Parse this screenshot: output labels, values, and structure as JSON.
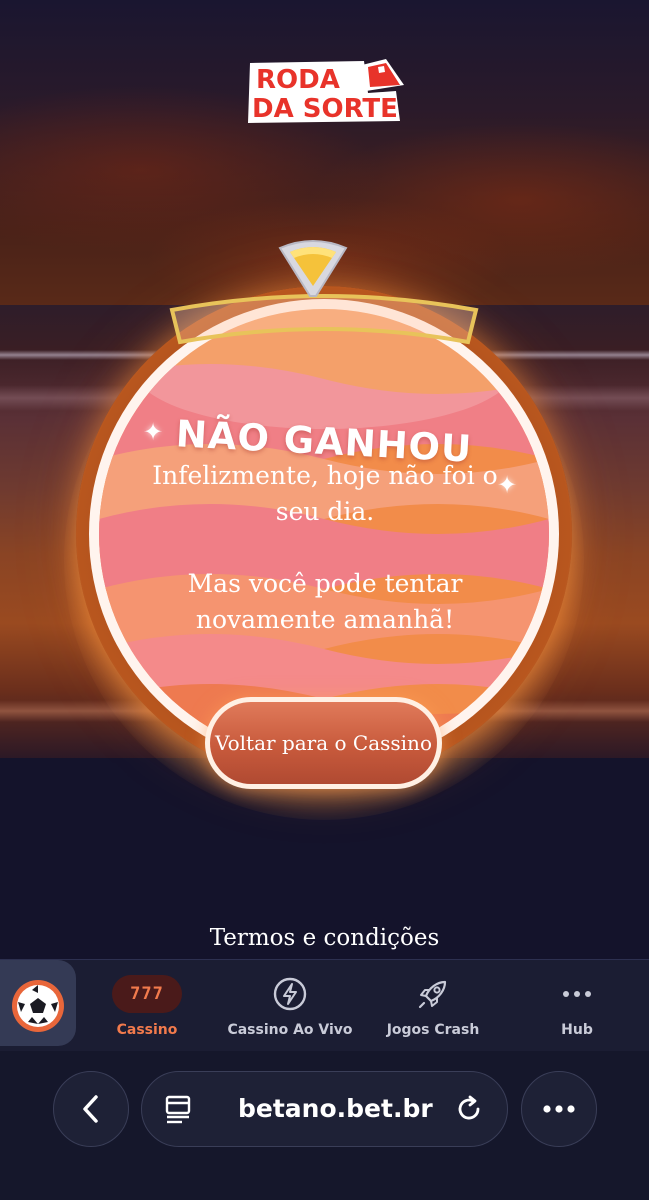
{
  "logo": {
    "line1": "RODA",
    "line2": "DA SORTE"
  },
  "result": {
    "title": "NÃO GANHOU",
    "message_line1": "Infelizmente, hoje não foi o seu dia.",
    "message_line2": "Mas você pode tentar novamente amanhã!",
    "button_label": "Voltar para o Cassino"
  },
  "terms_label": "Termos e condições",
  "bottom_nav": {
    "items": [
      {
        "label": "Cassino",
        "icon": "slot-777-icon",
        "icon_text": "777",
        "active": true
      },
      {
        "label": "Cassino Ao Vivo",
        "icon": "lightning-icon"
      },
      {
        "label": "Jogos Crash",
        "icon": "rocket-icon"
      },
      {
        "label": "Hub",
        "icon": "more-dots-icon"
      }
    ]
  },
  "browser": {
    "url": "betano.bet.br"
  },
  "colors": {
    "accent": "#f27a4c",
    "wheel_pink": "#f07f86",
    "wheel_orange": "#f28c4a",
    "background": "#14132b"
  }
}
